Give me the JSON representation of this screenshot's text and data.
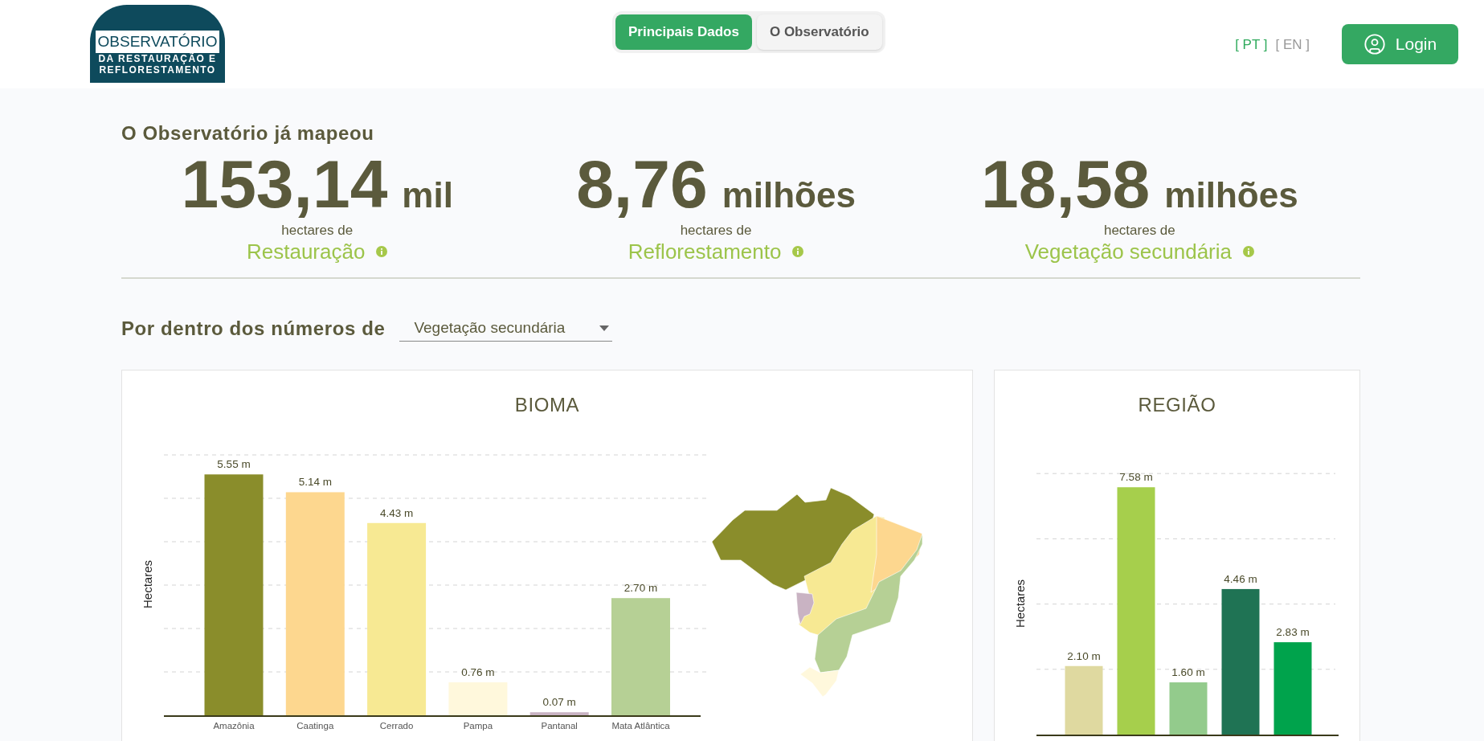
{
  "logo": {
    "title": "OBSERVATÓRIO",
    "subtitle_lines": [
      "DA RESTAURAÇÃO E",
      "REFLORESTAMENTO"
    ]
  },
  "nav_tabs": [
    {
      "label": "Principais Dados",
      "selected": true
    },
    {
      "label": "O Observatório",
      "selected": false
    }
  ],
  "languages": [
    {
      "label": "[ PT ]",
      "selected": true
    },
    {
      "label": "[ EN ]",
      "selected": false
    }
  ],
  "login_button": {
    "label": "Login"
  },
  "summary": {
    "title": "O Observatório já mapeou",
    "stats": [
      {
        "value": "153,14",
        "unit": "mil",
        "caption": "hectares de",
        "category": "Restauração"
      },
      {
        "value": "8,76",
        "unit": "milhões",
        "caption": "hectares de",
        "category": "Reflorestamento"
      },
      {
        "value": "18,58",
        "unit": "milhões",
        "caption": "hectares de",
        "category": "Vegetação secundária"
      }
    ]
  },
  "filter": {
    "label": "Por dentro dos números de",
    "dropdown_value": "Vegetação secundária"
  },
  "bioma_panel": {
    "title": "BIOMA",
    "chart_data": {
      "type": "bar",
      "ylabel": "Hectares",
      "categories": [
        "Amazônia",
        "Caatinga",
        "Cerrado",
        "Pampa",
        "Pantanal",
        "Mata Atlântica"
      ],
      "stacked": true,
      "series": [
        {
          "color": "#8a8d2b",
          "values": [
            5.55,
            null,
            null,
            null,
            null,
            null
          ],
          "value_labels": [
            "5.55 m",
            null,
            null,
            null,
            null,
            null
          ]
        },
        {
          "color": "#fdd78f",
          "values": [
            null,
            5.14,
            null,
            null,
            null,
            null
          ],
          "value_labels": [
            null,
            "5.14 m",
            null,
            null,
            null,
            null
          ]
        },
        {
          "color": "#f7e993",
          "values": [
            null,
            null,
            4.43,
            null,
            null,
            null
          ],
          "value_labels": [
            null,
            null,
            "4.43 m",
            null,
            null,
            null
          ]
        },
        {
          "color": "#fff8dc",
          "values": [
            null,
            null,
            null,
            0.76,
            null,
            null
          ],
          "value_labels": [
            null,
            null,
            null,
            "0.76 m",
            null,
            null
          ]
        },
        {
          "color": "#c9b3c3",
          "values": [
            null,
            null,
            null,
            null,
            0.07,
            null
          ],
          "value_labels": [
            null,
            null,
            null,
            null,
            "0.07 m",
            null
          ]
        },
        {
          "color": "#b6d095",
          "values": [
            null,
            null,
            null,
            null,
            null,
            2.7
          ],
          "value_labels": [
            null,
            null,
            null,
            null,
            null,
            "2.70 m"
          ]
        }
      ]
    }
  },
  "regiao_panel": {
    "title": "REGIÃO",
    "chart_data": {
      "type": "bar",
      "ylabel": "Hectares",
      "categories": [
        null,
        null,
        null,
        null,
        null
      ],
      "stacked": true,
      "series": [
        {
          "color": "#dfd9a0",
          "values": [
            2.1,
            null,
            null,
            null,
            null
          ],
          "value_labels": [
            "2.10 m",
            null,
            null,
            null,
            null
          ]
        },
        {
          "color": "#a6cf4c",
          "values": [
            null,
            7.58,
            null,
            null,
            null
          ],
          "value_labels": [
            null,
            "7.58 m",
            null,
            null,
            null
          ]
        },
        {
          "color": "#93cb8c",
          "values": [
            null,
            null,
            1.6,
            null,
            null
          ],
          "value_labels": [
            null,
            null,
            "1.60 m",
            null,
            null
          ]
        },
        {
          "color": "#1f7354",
          "values": [
            null,
            null,
            null,
            4.46,
            null
          ],
          "value_labels": [
            null,
            null,
            null,
            "4.46 m",
            null
          ]
        },
        {
          "color": "#00a34c",
          "values": [
            null,
            null,
            null,
            null,
            2.83
          ],
          "value_labels": [
            null,
            null,
            null,
            null,
            "2.83 m"
          ]
        }
      ]
    }
  }
}
